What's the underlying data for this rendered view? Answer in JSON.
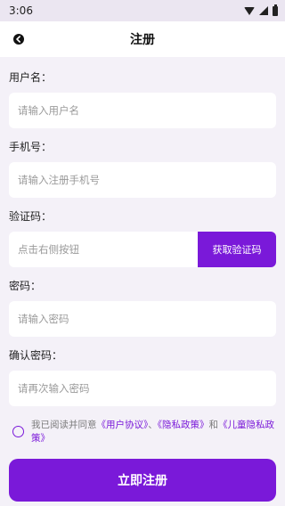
{
  "status_bar": {
    "time": "3:06"
  },
  "header": {
    "title": "注册"
  },
  "form": {
    "username": {
      "label": "用户名：",
      "placeholder": "请输入用户名"
    },
    "phone": {
      "label": "手机号：",
      "placeholder": "请输入注册手机号"
    },
    "code": {
      "label": "验证码：",
      "placeholder": "点击右侧按钮",
      "button": "获取验证码"
    },
    "password": {
      "label": "密码：",
      "placeholder": "请输入密码"
    },
    "confirm": {
      "label": "确认密码：",
      "placeholder": "请再次输入密码"
    }
  },
  "agreement": {
    "prefix": "我已阅读并同意",
    "user_agreement": "《用户协议》",
    "sep1": "、",
    "privacy": "《隐私政策》",
    "and": "和",
    "children_privacy": "《儿童隐私政策》"
  },
  "submit_label": "立即注册",
  "colors": {
    "accent": "#7a19d9",
    "background": "#f4f1f8"
  }
}
